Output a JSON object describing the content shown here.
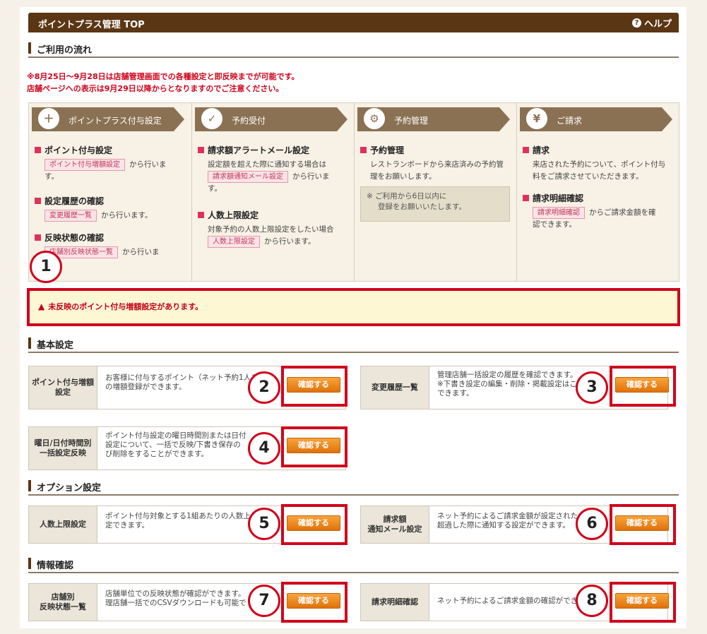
{
  "header": {
    "title": "ポイントプラス管理 TOP",
    "help_label": "ヘルプ"
  },
  "flow_section": {
    "title": "ご利用の流れ"
  },
  "notice": {
    "line1": "※8月25日～9月28日は店舗管理画面での各種設定と即反映までが可能です。",
    "line2": "店舗ページへの表示は9月29日以降からとなりますのでご注意ください。"
  },
  "steps": [
    {
      "title": "ポイントプラス付与設定",
      "icon": "coin-plus-icon",
      "items": [
        {
          "heading": "ポイント付与設定",
          "link": "ポイント付与増額設定",
          "text1": "から行いま",
          "text2": "す。"
        },
        {
          "heading": "設定履歴の確認",
          "link": "変更履歴一覧",
          "text1": "から行います。",
          "text2": ""
        },
        {
          "heading": "反映状態の確認",
          "link": "店舗別反映状態一覧",
          "text1": "から行いま",
          "text2": ""
        }
      ]
    },
    {
      "title": "予約受付",
      "icon": "calendar-check-icon",
      "items": [
        {
          "heading": "請求額アラートメール設定",
          "line1": "設定額を超えた際に通知する場合は",
          "link": "請求額通知メール設定",
          "text1": "から行いま",
          "text2": "す。"
        },
        {
          "heading": "人数上限設定",
          "line1": "対象予約の人数上限設定をしたい場合",
          "link": "人数上限設定",
          "text1": "から行います。",
          "text2": ""
        }
      ]
    },
    {
      "title": "予約管理",
      "icon": "calendar-gear-icon",
      "items": [
        {
          "heading": "予約管理",
          "line1": "レストランボードから来店済みの予約管",
          "line2": "理をお願いします。"
        }
      ],
      "note1": "※ ご利用から6日以内に",
      "note2": "登録をお願いいたします。"
    },
    {
      "title": "ご請求",
      "icon": "yen-hand-icon",
      "items": [
        {
          "heading": "請求",
          "line1": "来店された予約について、ポイント付与",
          "line2": "料をご請求させていただきます。"
        },
        {
          "heading": "請求明細確認",
          "link": "請求明細確認",
          "text1": "からご請求金額を確",
          "text2": "認できます。"
        }
      ]
    }
  ],
  "alert": {
    "text": "未反映のポイント付与増額設定があります。"
  },
  "sections": {
    "basic": "基本設定",
    "option": "オプション設定",
    "info": "情報確認"
  },
  "cards": {
    "c1": {
      "label1": "ポイント付与増額",
      "label2": "設定",
      "desc1": "お客様に付与するポイント（ネット予約1人あ",
      "desc2": "の増額登録ができます。",
      "button": "確認する"
    },
    "c2": {
      "label1": "変更履歴一覧",
      "label2": "",
      "desc1": "管理店舗一括設定の履歴を確認できます。",
      "desc2": "※下書き設定の編集・削除・掲載設定はこ",
      "desc3": "できます。",
      "button": "確認する"
    },
    "c3": {
      "label1": "曜日/日付時間別",
      "label2": "一括設定反映",
      "desc1": "ポイント付与設定の曜日時間別または日付",
      "desc2": "設定について、一括で反映/下書き保存の",
      "desc3": "び削除をすることができます。",
      "button": "確認する"
    },
    "c4": {
      "label1": "人数上限設定",
      "label2": "",
      "desc1": "ポイント付与対象とする1組あたりの人数上",
      "desc2": "定できます。",
      "button": "確認する"
    },
    "c5": {
      "label1": "請求額",
      "label2": "通知メール設定",
      "desc1": "ネット予約によるご請求金額が設定された",
      "desc2": "超過した際に通知する設定ができます。",
      "button": "確認する"
    },
    "c6": {
      "label1": "店舗別",
      "label2": "反映状態一覧",
      "desc1": "店舗単位での反映状態が確認ができます。",
      "desc2": "理店舗一括でのCSVダウンロードも可能で",
      "button": "確認する"
    },
    "c7": {
      "label1": "請求明細確認",
      "label2": "",
      "desc1": "ネット予約によるご請求金額の確認ができ",
      "desc2": "",
      "button": "確認する"
    }
  },
  "markers": [
    "1",
    "2",
    "3",
    "4",
    "5",
    "6",
    "7",
    "8"
  ]
}
